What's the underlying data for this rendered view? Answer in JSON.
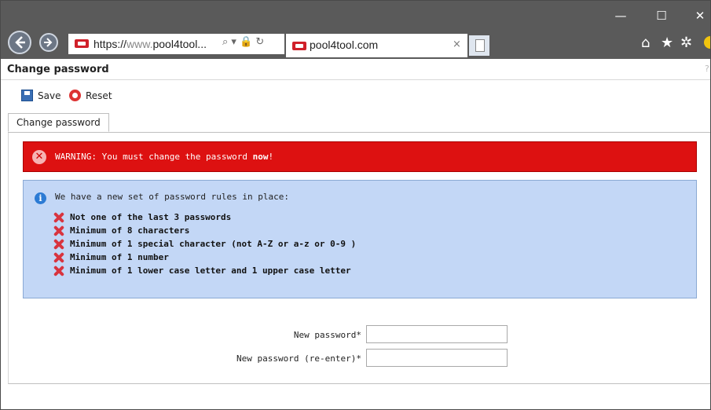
{
  "browser": {
    "address": {
      "scheme_host": "https://",
      "dim": "www.",
      "domain": "pool4tool...",
      "icons": "⌕ ▾ 🔒 ↻"
    },
    "tab": {
      "title": "pool4tool.com",
      "close": "×"
    },
    "window_controls": {
      "minimize": "—",
      "maximize": "☐",
      "close": "✕"
    },
    "toolbar_icons": {
      "home": "⌂",
      "favorites": "★",
      "settings": "✲"
    }
  },
  "page": {
    "title": "Change password",
    "help": "?",
    "toolbar": {
      "save_label": "Save",
      "reset_label": "Reset"
    },
    "tab_label": "Change password",
    "warning": {
      "prefix": "WARNING: You must change the password ",
      "emphasis": "now",
      "suffix": "!"
    },
    "rules": {
      "intro": "We have a new set of password rules in place:",
      "items": [
        "Not one of the last 3 passwords",
        "Minimum of 8 characters",
        "Minimum of 1 special character (not A-Z or a-z or 0-9 )",
        "Minimum of 1 number",
        "Minimum of 1 lower case letter and 1 upper case letter"
      ]
    },
    "form": {
      "new_password_label": "New password*",
      "new_password_value": "",
      "reenter_label": "New password (re-enter)*",
      "reenter_value": ""
    }
  },
  "colors": {
    "warning_bg": "#dd1111",
    "info_bg": "#c3d7f6",
    "chrome_bg": "#5a5a5a"
  }
}
